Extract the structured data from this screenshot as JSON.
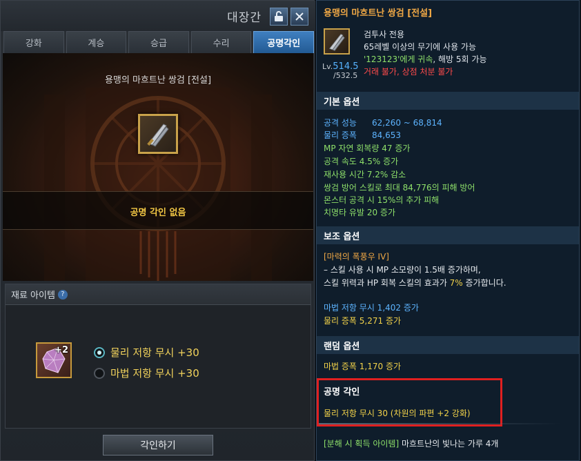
{
  "window": {
    "title": "대장간",
    "tabs": [
      "강화",
      "계승",
      "승급",
      "수리",
      "공명각인"
    ],
    "active_tab": "공명각인"
  },
  "scene": {
    "item_name": "용맹의 마흐트난 쌍검 [전설]",
    "status": "공명 각인 없음"
  },
  "materials": {
    "header": "재료 아이템",
    "help_icon": "?",
    "item_badge": "+2",
    "options": [
      {
        "label": "물리 저항 무시 +30",
        "selected": true
      },
      {
        "label": "마법 저항 무시 +30",
        "selected": false
      }
    ]
  },
  "engrave_button": "각인하기",
  "tooltip": {
    "name": "용맹의 마흐트난 쌍검 [전설]",
    "level_label": "Lv.",
    "level": "514.5",
    "level_max": "/532.5",
    "class_only": "검투사 전용",
    "req_level": "65레벨 이상의 무기에 사용 가능",
    "bound_owner": "'123123'",
    "bound_suffix": "에게 귀속",
    "unseal": ", 해방 5회 가능",
    "trade": "거래 불가, 상점 처분 불가",
    "basic_header": "기본 옵션",
    "attack_label": "공격 성능",
    "attack_value": "62,260 ~ 68,814",
    "amp_label": "물리 증폭",
    "amp_value": "84,653",
    "basic_lines": [
      "MP 자연 회복량 47 증가",
      "공격 속도 4.5% 증가",
      "재사용 시간 7.2% 감소",
      "쌍검 방어 스킬로 최대 84,776의 피해 방어",
      "몬스터 공격 시 15%의 추가 피해",
      "치명타 유발 20 증가"
    ],
    "aux_header": "보조 옵션",
    "aux_skill": "[마력의 폭풍우 IV]",
    "aux_desc1": "– 스킬 사용 시 MP 소모량이 1.5배 증가하며,",
    "aux_desc2_a": "스킬 위력과 HP 회복 스킬의 효과가 ",
    "aux_desc2_pct": "7%",
    "aux_desc2_b": " 증가합니다.",
    "aux_line1": "마법 저항 무시 1,402 증가",
    "aux_line2": "물리 증폭 5,271 증가",
    "random_header": "랜덤 옵션",
    "random_line": "마법 증폭 1,170 증가",
    "resonance_header": "공명 각인",
    "resonance_line": "물리 저항 무시 30 (차원의 파편 +2 강화)",
    "disassemble_label": "[분해 시 획득 아이템]",
    "disassemble_value": " 마흐트난의 빛나는 가루 4개"
  },
  "colors": {
    "highlight_box": "#e02020",
    "active_tab": "#2f6fae",
    "tooltip_bg": "#0f1d2b",
    "gold_text": "#f3d34a",
    "blue_text": "#5db4ff"
  },
  "icons": {
    "lock": "lock-open-icon",
    "close": "close-icon",
    "weapon": "dual-sword-icon",
    "material": "crystal-shard-icon",
    "help": "help-icon"
  }
}
